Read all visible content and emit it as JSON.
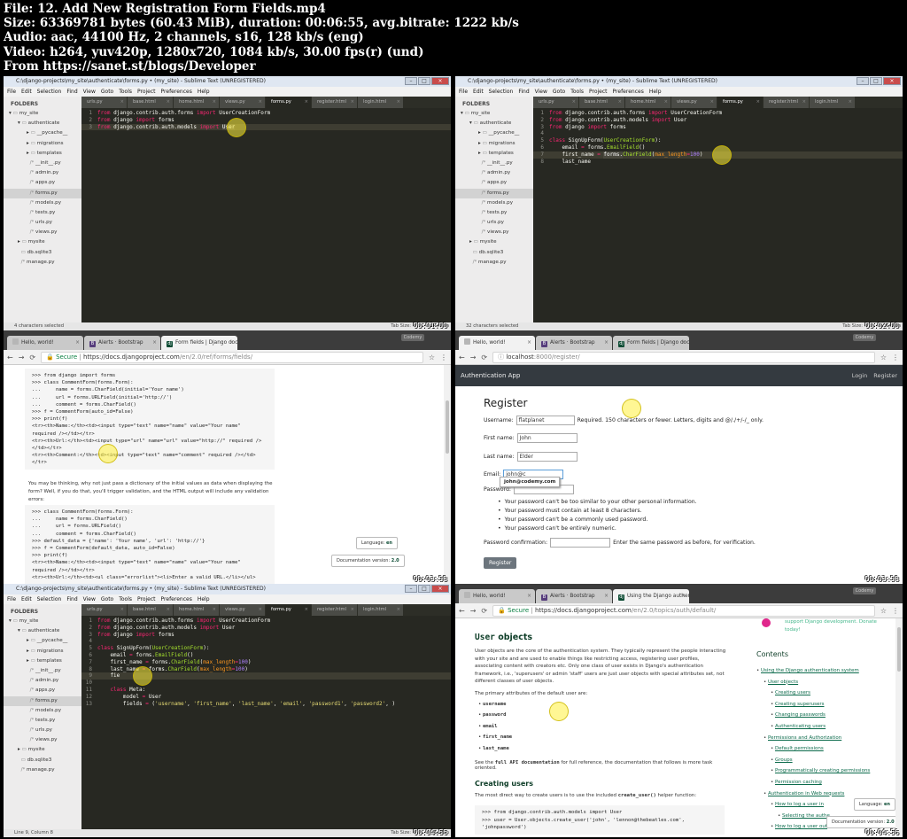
{
  "header": {
    "lines": [
      "File: 12. Add New Registration Form Fields.mp4",
      "Size: 63369781 bytes (60.43 MiB), duration: 00:06:55, avg.bitrate: 1222 kb/s",
      "Audio: aac, 44100 Hz, 2 channels, s16, 128 kb/s (eng)",
      "Video: h264, yuv420p, 1280x720, 1084 kb/s, 30.00 fps(r) (und)",
      "From https://sanet.st/blogs/Developer"
    ]
  },
  "editor_common": {
    "menu": [
      "File",
      "Edit",
      "Selection",
      "Find",
      "View",
      "Goto",
      "Tools",
      "Project",
      "Preferences",
      "Help"
    ],
    "tabs": [
      "urls.py",
      "base.html",
      "home.html",
      "views.py",
      "forms.py",
      "register.html",
      "login.html"
    ],
    "folders_label": "FOLDERS",
    "tab_size": "Tab Size: 4",
    "syntax": "Python",
    "close_glyph": "×"
  },
  "editor1": {
    "title": "C:\\django-projects\\my_site\\authenticate\\forms.py • (my_site) - Sublime Text (UNREGISTERED)",
    "tree": [
      {
        "d": 0,
        "a": "▾",
        "i": "▸",
        "t": "my_site"
      },
      {
        "d": 1,
        "a": "▾",
        "i": "▸",
        "t": "authenticate"
      },
      {
        "d": 2,
        "a": "▸",
        "i": "▸",
        "t": "__pycache__"
      },
      {
        "d": 2,
        "a": "▸",
        "i": "▸",
        "t": "migrations"
      },
      {
        "d": 2,
        "a": "▸",
        "i": "▸",
        "t": "templates"
      },
      {
        "d": 2,
        "a": "",
        "i": "/*",
        "t": "__init__.py"
      },
      {
        "d": 2,
        "a": "",
        "i": "/*",
        "t": "admin.py"
      },
      {
        "d": 2,
        "a": "",
        "i": "/*",
        "t": "apps.py"
      },
      {
        "d": 2,
        "a": "",
        "i": "/*",
        "t": "forms.py",
        "sel": true
      },
      {
        "d": 2,
        "a": "",
        "i": "/*",
        "t": "models.py"
      },
      {
        "d": 2,
        "a": "",
        "i": "/*",
        "t": "tests.py"
      },
      {
        "d": 2,
        "a": "",
        "i": "/*",
        "t": "urls.py"
      },
      {
        "d": 2,
        "a": "",
        "i": "/*",
        "t": "views.py"
      },
      {
        "d": 1,
        "a": "▸",
        "i": "▸",
        "t": "mysite"
      },
      {
        "d": 1,
        "a": "",
        "i": "",
        "t": "db.sqlite3"
      },
      {
        "d": 1,
        "a": "",
        "i": "/*",
        "t": "manage.py"
      }
    ],
    "code": [
      [
        [
          "from ",
          "kw"
        ],
        [
          "django.contrib.auth.forms ",
          ""
        ],
        [
          "import ",
          "kw"
        ],
        [
          "UserCreationForm",
          ""
        ]
      ],
      [
        [
          "from ",
          "kw"
        ],
        [
          "django ",
          ""
        ],
        [
          "import ",
          "kw"
        ],
        [
          "forms",
          ""
        ]
      ],
      [
        [
          "from ",
          "kw"
        ],
        [
          "django.contrib.auth.models ",
          ""
        ],
        [
          "import ",
          "kw"
        ],
        [
          "User",
          "sel"
        ]
      ]
    ],
    "cursor_line": 3,
    "status": "4 characters selected",
    "timestamp": "00:01:00"
  },
  "editor2": {
    "title": "C:\\django-projects\\my_site\\authenticate\\forms.py • (my_site) - Sublime Text (UNREGISTERED)",
    "tree": [
      {
        "d": 0,
        "a": "▾",
        "i": "▸",
        "t": "my_site"
      },
      {
        "d": 1,
        "a": "▾",
        "i": "▸",
        "t": "authenticate"
      },
      {
        "d": 2,
        "a": "▸",
        "i": "▸",
        "t": "__pycache__"
      },
      {
        "d": 2,
        "a": "▸",
        "i": "▸",
        "t": "migrations"
      },
      {
        "d": 2,
        "a": "▸",
        "i": "▸",
        "t": "templates"
      },
      {
        "d": 2,
        "a": "",
        "i": "/*",
        "t": "__init__.py"
      },
      {
        "d": 2,
        "a": "",
        "i": "/*",
        "t": "admin.py"
      },
      {
        "d": 2,
        "a": "",
        "i": "/*",
        "t": "apps.py"
      },
      {
        "d": 2,
        "a": "",
        "i": "/*",
        "t": "forms.py",
        "sel": true
      },
      {
        "d": 2,
        "a": "",
        "i": "/*",
        "t": "models.py"
      },
      {
        "d": 2,
        "a": "",
        "i": "/*",
        "t": "tests.py"
      },
      {
        "d": 2,
        "a": "",
        "i": "/*",
        "t": "urls.py"
      },
      {
        "d": 2,
        "a": "",
        "i": "/*",
        "t": "views.py"
      },
      {
        "d": 1,
        "a": "▸",
        "i": "▸",
        "t": "mysite"
      },
      {
        "d": 1,
        "a": "",
        "i": "",
        "t": "db.sqlite3"
      },
      {
        "d": 1,
        "a": "",
        "i": "/*",
        "t": "manage.py"
      }
    ],
    "code": [
      [
        [
          "from ",
          "kw"
        ],
        [
          "django.contrib.auth.forms ",
          ""
        ],
        [
          "import ",
          "kw"
        ],
        [
          "UserCreationForm",
          ""
        ]
      ],
      [
        [
          "from ",
          "kw"
        ],
        [
          "django.contrib.auth.models ",
          ""
        ],
        [
          "import ",
          "kw"
        ],
        [
          "User",
          ""
        ]
      ],
      [
        [
          "from ",
          "kw"
        ],
        [
          "django ",
          ""
        ],
        [
          "import ",
          "kw"
        ],
        [
          "forms",
          ""
        ]
      ],
      [],
      [
        [
          "class ",
          "kw"
        ],
        [
          "SignUpForm",
          ""
        ],
        [
          "(",
          ""
        ],
        [
          "UserCreationForm",
          "nm"
        ],
        [
          "):",
          ""
        ]
      ],
      [
        [
          "    email ",
          ""
        ],
        [
          "= ",
          "kw"
        ],
        [
          "forms.",
          ""
        ],
        [
          "EmailField",
          "nm"
        ],
        [
          "()",
          ""
        ]
      ],
      [
        [
          "    first_name ",
          ""
        ],
        [
          "= ",
          "kw"
        ],
        [
          "forms.",
          "sel"
        ],
        [
          "CharField",
          "nm"
        ],
        [
          "(",
          ""
        ],
        [
          "max_length",
          "ar"
        ],
        [
          "=",
          "kw"
        ],
        [
          "100",
          "num"
        ],
        [
          ")",
          ""
        ]
      ],
      [
        [
          "    last_name",
          ""
        ]
      ]
    ],
    "cursor_line": 7,
    "status": "32 characters selected",
    "timestamp": "00:02:00"
  },
  "editor3": {
    "title": "C:\\django-projects\\my_site\\authenticate\\forms.py • (my_site) - Sublime Text (UNREGISTERED)",
    "tree": [
      {
        "d": 0,
        "a": "▾",
        "i": "▸",
        "t": "my_site"
      },
      {
        "d": 1,
        "a": "▾",
        "i": "▸",
        "t": "authenticate"
      },
      {
        "d": 2,
        "a": "▸",
        "i": "▸",
        "t": "__pycache__"
      },
      {
        "d": 2,
        "a": "▸",
        "i": "▸",
        "t": "migrations"
      },
      {
        "d": 2,
        "a": "▸",
        "i": "▸",
        "t": "templates"
      },
      {
        "d": 2,
        "a": "",
        "i": "/*",
        "t": "__init__.py"
      },
      {
        "d": 2,
        "a": "",
        "i": "/*",
        "t": "admin.py"
      },
      {
        "d": 2,
        "a": "",
        "i": "/*",
        "t": "apps.py"
      },
      {
        "d": 2,
        "a": "",
        "i": "/*",
        "t": "forms.py",
        "sel": true
      },
      {
        "d": 2,
        "a": "",
        "i": "/*",
        "t": "models.py"
      },
      {
        "d": 2,
        "a": "",
        "i": "/*",
        "t": "tests.py"
      },
      {
        "d": 2,
        "a": "",
        "i": "/*",
        "t": "urls.py"
      },
      {
        "d": 2,
        "a": "",
        "i": "/*",
        "t": "views.py"
      },
      {
        "d": 1,
        "a": "▸",
        "i": "▸",
        "t": "mysite"
      },
      {
        "d": 1,
        "a": "",
        "i": "",
        "t": "db.sqlite3"
      },
      {
        "d": 1,
        "a": "",
        "i": "/*",
        "t": "manage.py"
      }
    ],
    "code": [
      [
        [
          "from ",
          "kw"
        ],
        [
          "django.contrib.auth.forms ",
          ""
        ],
        [
          "import ",
          "kw"
        ],
        [
          "UserCreationForm",
          ""
        ]
      ],
      [
        [
          "from ",
          "kw"
        ],
        [
          "django.contrib.auth.models ",
          ""
        ],
        [
          "import ",
          "kw"
        ],
        [
          "User",
          ""
        ]
      ],
      [
        [
          "from ",
          "kw"
        ],
        [
          "django ",
          ""
        ],
        [
          "import ",
          "kw"
        ],
        [
          "forms",
          ""
        ]
      ],
      [],
      [
        [
          "class ",
          "kw"
        ],
        [
          "SignUpForm",
          ""
        ],
        [
          "(",
          ""
        ],
        [
          "UserCreationForm",
          "nm"
        ],
        [
          "):",
          ""
        ]
      ],
      [
        [
          "    email ",
          ""
        ],
        [
          "= ",
          "kw"
        ],
        [
          "forms.",
          ""
        ],
        [
          "EmailField",
          "nm"
        ],
        [
          "()",
          ""
        ]
      ],
      [
        [
          "    first_name ",
          ""
        ],
        [
          "= ",
          "kw"
        ],
        [
          "forms.",
          ""
        ],
        [
          "CharField",
          "nm"
        ],
        [
          "(",
          ""
        ],
        [
          "max_length",
          "ar"
        ],
        [
          "=",
          "kw"
        ],
        [
          "100",
          "num"
        ],
        [
          ")",
          ""
        ]
      ],
      [
        [
          "    last_name ",
          ""
        ],
        [
          "= ",
          "kw"
        ],
        [
          "forms.",
          ""
        ],
        [
          "CharField",
          "nm"
        ],
        [
          "(",
          ""
        ],
        [
          "max_length",
          "ar"
        ],
        [
          "=",
          "kw"
        ],
        [
          "100",
          "num"
        ],
        [
          ")",
          ""
        ]
      ],
      [
        [
          "    fie",
          ""
        ]
      ],
      [],
      [
        [
          "    class ",
          "kw"
        ],
        [
          "Meta",
          ""
        ],
        [
          ":",
          ""
        ]
      ],
      [
        [
          "        model ",
          ""
        ],
        [
          "= ",
          "kw"
        ],
        [
          "User",
          ""
        ]
      ],
      [
        [
          "        fields ",
          ""
        ],
        [
          "= ",
          "kw"
        ],
        [
          "(",
          ""
        ],
        [
          "'username'",
          "str"
        ],
        [
          ", ",
          ""
        ],
        [
          "'first_name'",
          "str"
        ],
        [
          ", ",
          ""
        ],
        [
          "'last_name'",
          "str"
        ],
        [
          ", ",
          ""
        ],
        [
          "'email'",
          "str"
        ],
        [
          ", ",
          ""
        ],
        [
          "'password1'",
          "str"
        ],
        [
          ", ",
          ""
        ],
        [
          "'password2'",
          "str"
        ],
        [
          ", )",
          ""
        ]
      ]
    ],
    "cursor_line": 9,
    "status": "Line 9, Column 8",
    "timestamp": "00:04:56"
  },
  "browser1": {
    "tabs": [
      {
        "fav": "",
        "t": "Hello, world!"
      },
      {
        "fav": "B",
        "t": "Alerts · Bootstrap"
      },
      {
        "fav": "dj",
        "t": "Form fields | Django doc",
        "on": true
      }
    ],
    "profile": "Codemy",
    "secure": "Secure",
    "url_host": "https://docs.djangoproject.com",
    "url_path": "/en/2.0/ref/forms/fields/",
    "code1": [
      ">>> from django import forms",
      ">>> class CommentForm(forms.Form):",
      "...     name = forms.CharField(initial='Your name')",
      "...     url = forms.URLField(initial='http://')",
      "...     comment = forms.CharField()",
      ">>> f = CommentForm(auto_id=False)",
      ">>> print(f)",
      "<tr><th>Name:</th><td><input type=\"text\" name=\"name\" value=\"Your name\"",
      "required /></td></tr>",
      "<tr><th>Url:</th><td><input type=\"url\" name=\"url\" value=\"http://\" required />",
      "</td></tr>",
      "<tr><th>Comment:</th><td><input type=\"text\" name=\"comment\" required /></td>",
      "</tr>"
    ],
    "para": "You may be thinking, why not just pass a dictionary of the initial values as data when displaying the form? Well, if you do that, you'll trigger validation, and the HTML output will include any validation errors:",
    "code2": [
      ">>> class CommentForm(forms.Form):",
      "...     name = forms.CharField()",
      "...     url = forms.URLField()",
      "...     comment = forms.CharField()",
      ">>> default_data = {'name': 'Your name', 'url': 'http://'}",
      ">>> f = CommentForm(default_data, auto_id=False)",
      ">>> print(f)",
      "<tr><th>Name:</th><td><input type=\"text\" name=\"name\" value=\"Your name\"",
      "required /></td></tr>",
      "<tr><th>Url:</th><td><ul class=\"errorlist\"><li>Enter a valid URL.</li></ul>"
    ],
    "lang_label": "Language:",
    "lang": "en",
    "docver_label": "Documentation version:",
    "docver": "2.0",
    "timestamp": "00:03:58"
  },
  "browser2": {
    "tabs": [
      {
        "fav": "",
        "t": "Hello, world!",
        "on": true
      },
      {
        "fav": "B",
        "t": "Alerts · Bootstrap"
      },
      {
        "fav": "dj",
        "t": "Form fields | Django doc"
      }
    ],
    "profile": "Codemy",
    "url_host": "localhost",
    "url_path": ":8000/register/",
    "brand": "Authentication App",
    "nav": [
      "Login",
      "Register"
    ],
    "heading": "Register",
    "username_label": "Username:",
    "username_value": "flatplanet",
    "username_help": "Required. 150 characters or fewer. Letters, digits and @/./+/-/_ only.",
    "first_label": "First name:",
    "first_value": "John",
    "last_label": "Last name:",
    "last_value": "Elder",
    "email_label": "Email:",
    "email_value": "john@c",
    "autocomplete": "john@codemy.com",
    "password_label": "Password:",
    "rules": [
      "Your password can't be too similar to your other personal information.",
      "Your password must contain at least 8 characters.",
      "Your password can't be a commonly used password.",
      "Your password can't be entirely numeric."
    ],
    "confirm_label": "Password confirmation:",
    "confirm_help": "Enter the same password as before, for verification.",
    "button": "Register",
    "timestamp": "00:03:58"
  },
  "browser3": {
    "tabs": [
      {
        "fav": "",
        "t": "Hello, world!"
      },
      {
        "fav": "B",
        "t": "Alerts · Bootstrap"
      },
      {
        "fav": "dj",
        "t": "Using the Django authent",
        "on": true
      }
    ],
    "profile": "Codemy",
    "secure": "Secure",
    "url_host": "https://docs.djangoproject.com",
    "url_path": "/en/2.0/topics/auth/default/",
    "h_code": "User",
    "h_rest": " objects",
    "p1": "User objects are the core of the authentication system. They typically represent the people interacting with your site and are used to enable things like restricting access, registering user profiles, associating content with creators etc. Only one class of user exists in Django's authentication framework, i.e., 'superusers' or admin 'staff' users are just user objects with special attributes set, not different classes of user objects.",
    "p2": "The primary attributes of the default user are:",
    "attrs": [
      "username",
      "password",
      "email",
      "first_name",
      "last_name"
    ],
    "p3_pre": "See the ",
    "p3_code": "full API documentation",
    "p3_post": " for full reference, the documentation that follows is more task oriented.",
    "h3": "Creating users",
    "p4_pre": "The most direct way to create users is to use the included ",
    "p4_code": "create_user()",
    "p4_post": " helper function:",
    "code": [
      ">>> from django.contrib.auth.models import User",
      ">>> user = User.objects.create_user('john', 'lennon@thebeatles.com',",
      "'johnpassword')"
    ],
    "support": "support Django development. Donate today!",
    "contents": "Contents",
    "toc": [
      {
        "d": 0,
        "t": "Using the Django authentication system"
      },
      {
        "d": 1,
        "t": "User objects"
      },
      {
        "d": 2,
        "t": "Creating users"
      },
      {
        "d": 2,
        "t": "Creating superusers"
      },
      {
        "d": 2,
        "t": "Changing passwords"
      },
      {
        "d": 2,
        "t": "Authenticating users"
      },
      {
        "d": 1,
        "t": "Permissions and Authorization"
      },
      {
        "d": 2,
        "t": "Default permissions"
      },
      {
        "d": 2,
        "t": "Groups"
      },
      {
        "d": 2,
        "t": "Programmatically creating permissions"
      },
      {
        "d": 2,
        "t": "Permission caching"
      },
      {
        "d": 1,
        "t": "Authentication in Web requests"
      },
      {
        "d": 2,
        "t": "How to log a user in"
      },
      {
        "d": 3,
        "t": "Selecting the authe"
      },
      {
        "d": 2,
        "t": "How to log a user out"
      }
    ],
    "lang_label": "Language:",
    "lang": "en",
    "docver_label": "Documentation version:",
    "docver": "2.0",
    "timestamp": "00:04:56"
  },
  "colors": {
    "sublime_bg": "#272822",
    "keyword": "#f92672",
    "name": "#a6e22e",
    "arg": "#fd971f",
    "number": "#ae81ff",
    "string": "#e6db74",
    "django_green": "#0c4b33",
    "navbar": "#343a40"
  }
}
